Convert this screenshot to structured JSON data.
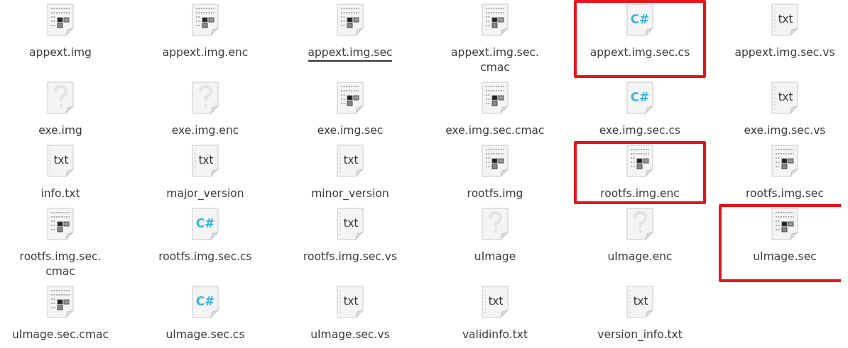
{
  "files": [
    {
      "name": "appext.img",
      "kind": "binary",
      "highlighted": false,
      "underlined": false
    },
    {
      "name": "appext.img.enc",
      "kind": "binary",
      "highlighted": false,
      "underlined": false
    },
    {
      "name": "appext.img.sec",
      "kind": "binary",
      "highlighted": false,
      "underlined": true
    },
    {
      "name": "appext.img.sec.\ncmac",
      "kind": "binary",
      "highlighted": false,
      "underlined": false
    },
    {
      "name": "appext.img.sec.cs",
      "kind": "csharp",
      "icon_text": "C#",
      "highlighted": true,
      "underlined": false
    },
    {
      "name": "appext.img.sec.vs",
      "kind": "text",
      "icon_text": "txt",
      "highlighted": false,
      "underlined": false
    },
    {
      "name": "exe.img",
      "kind": "unknown",
      "highlighted": false,
      "underlined": false
    },
    {
      "name": "exe.img.enc",
      "kind": "unknown",
      "highlighted": false,
      "underlined": false
    },
    {
      "name": "exe.img.sec",
      "kind": "binary",
      "highlighted": false,
      "underlined": false
    },
    {
      "name": "exe.img.sec.cmac",
      "kind": "binary",
      "highlighted": false,
      "underlined": false
    },
    {
      "name": "exe.img.sec.cs",
      "kind": "csharp",
      "icon_text": "C#",
      "highlighted": false,
      "underlined": false
    },
    {
      "name": "exe.img.sec.vs",
      "kind": "text",
      "icon_text": "txt",
      "highlighted": false,
      "underlined": false
    },
    {
      "name": "info.txt",
      "kind": "text",
      "icon_text": "txt",
      "highlighted": false,
      "underlined": false
    },
    {
      "name": "major_version",
      "kind": "text",
      "icon_text": "txt",
      "highlighted": false,
      "underlined": false
    },
    {
      "name": "minor_version",
      "kind": "text",
      "icon_text": "txt",
      "highlighted": false,
      "underlined": false
    },
    {
      "name": "rootfs.img",
      "kind": "binary",
      "highlighted": false,
      "underlined": false
    },
    {
      "name": "rootfs.img.enc",
      "kind": "binary",
      "highlighted": true,
      "underlined": false
    },
    {
      "name": "rootfs.img.sec",
      "kind": "binary",
      "highlighted": false,
      "underlined": false
    },
    {
      "name": "rootfs.img.sec.\ncmac",
      "kind": "binary",
      "highlighted": false,
      "underlined": false
    },
    {
      "name": "rootfs.img.sec.cs",
      "kind": "csharp",
      "icon_text": "C#",
      "highlighted": false,
      "underlined": false
    },
    {
      "name": "rootfs.img.sec.vs",
      "kind": "text",
      "icon_text": "txt",
      "highlighted": false,
      "underlined": false
    },
    {
      "name": "uImage",
      "kind": "unknown",
      "highlighted": false,
      "underlined": false
    },
    {
      "name": "uImage.enc",
      "kind": "unknown",
      "highlighted": false,
      "underlined": false
    },
    {
      "name": "uImage.sec",
      "kind": "binary",
      "highlighted": true,
      "underlined": false
    },
    {
      "name": "uImage.sec.cmac",
      "kind": "binary",
      "highlighted": false,
      "underlined": false
    },
    {
      "name": "uImage.sec.cs",
      "kind": "csharp",
      "icon_text": "C#",
      "highlighted": false,
      "underlined": false
    },
    {
      "name": "uImage.sec.vs",
      "kind": "text",
      "icon_text": "txt",
      "highlighted": false,
      "underlined": false
    },
    {
      "name": "validinfo.txt",
      "kind": "text",
      "icon_text": "txt",
      "highlighted": false,
      "underlined": false
    },
    {
      "name": "version_info.txt",
      "kind": "text",
      "icon_text": "txt",
      "highlighted": false,
      "underlined": false
    }
  ]
}
